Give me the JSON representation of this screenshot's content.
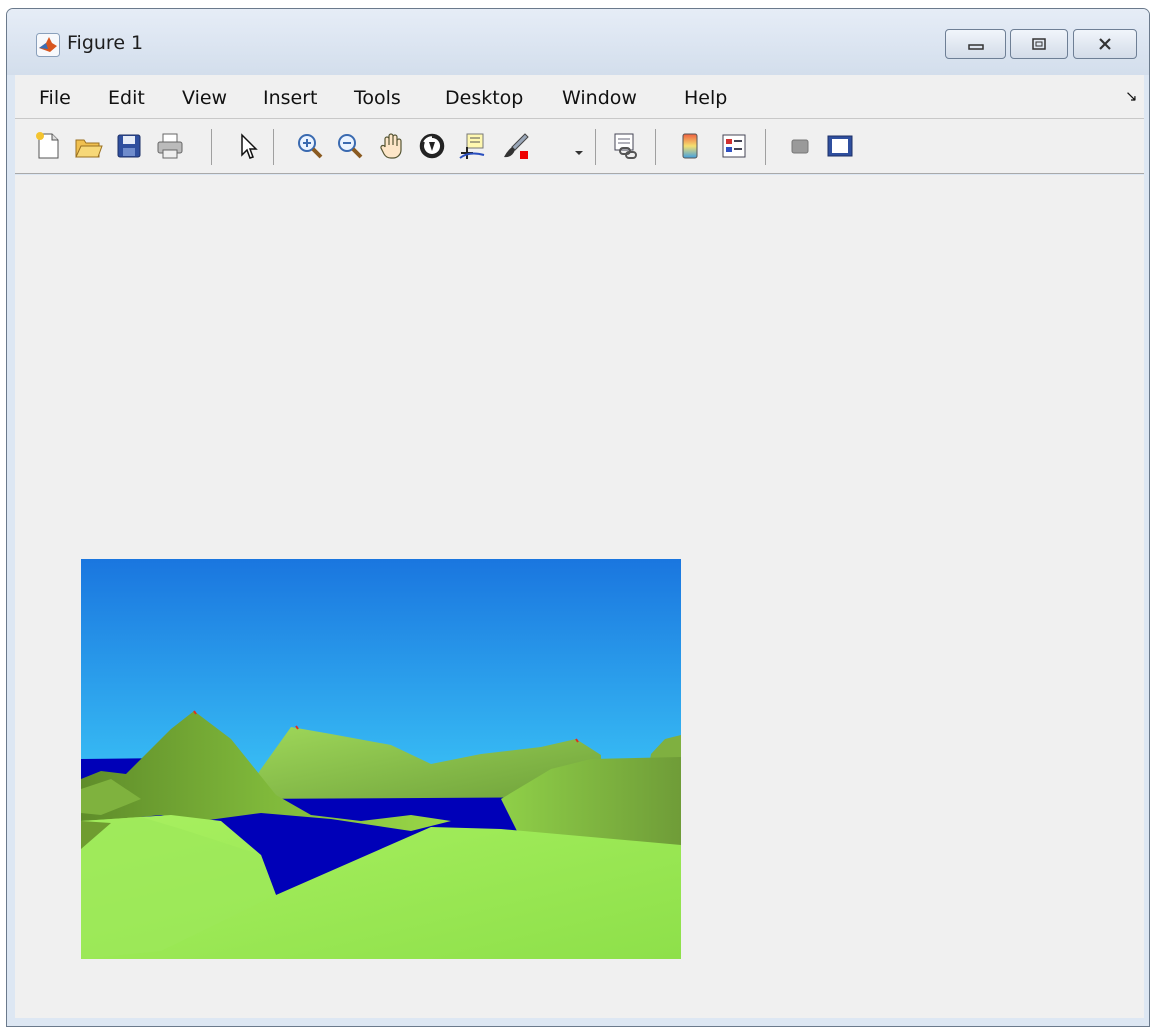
{
  "window": {
    "title": "Figure 1",
    "icon": "matlab-icon"
  },
  "window_controls": [
    "minimize-icon",
    "maximize-icon",
    "close-icon"
  ],
  "menu": {
    "items": [
      {
        "label": "File"
      },
      {
        "label": "Edit"
      },
      {
        "label": "View"
      },
      {
        "label": "Insert"
      },
      {
        "label": "Tools"
      },
      {
        "label": "Desktop"
      },
      {
        "label": "Window"
      },
      {
        "label": "Help"
      }
    ],
    "dock_arrow": "↘"
  },
  "toolbar": {
    "icons": [
      "new-figure-icon",
      "open-file-icon",
      "save-figure-icon",
      "print-figure-icon",
      "edit-plot-icon",
      "zoom-in-icon",
      "zoom-out-icon",
      "pan-icon",
      "rotate-3d-icon",
      "data-cursor-icon",
      "brush-icon",
      "link-plot-icon",
      "insert-colorbar-icon",
      "insert-legend-icon",
      "hide-plot-tools-icon",
      "show-plot-tools-icon"
    ]
  },
  "scene": {
    "description_icon": "terrain-render",
    "colors": {
      "sky_top": "#1a76df",
      "sky_bottom": "#45e2fb",
      "water": "#0000b8",
      "land_light": "#a4f25a",
      "land_dark": "#5f8c2a"
    }
  }
}
